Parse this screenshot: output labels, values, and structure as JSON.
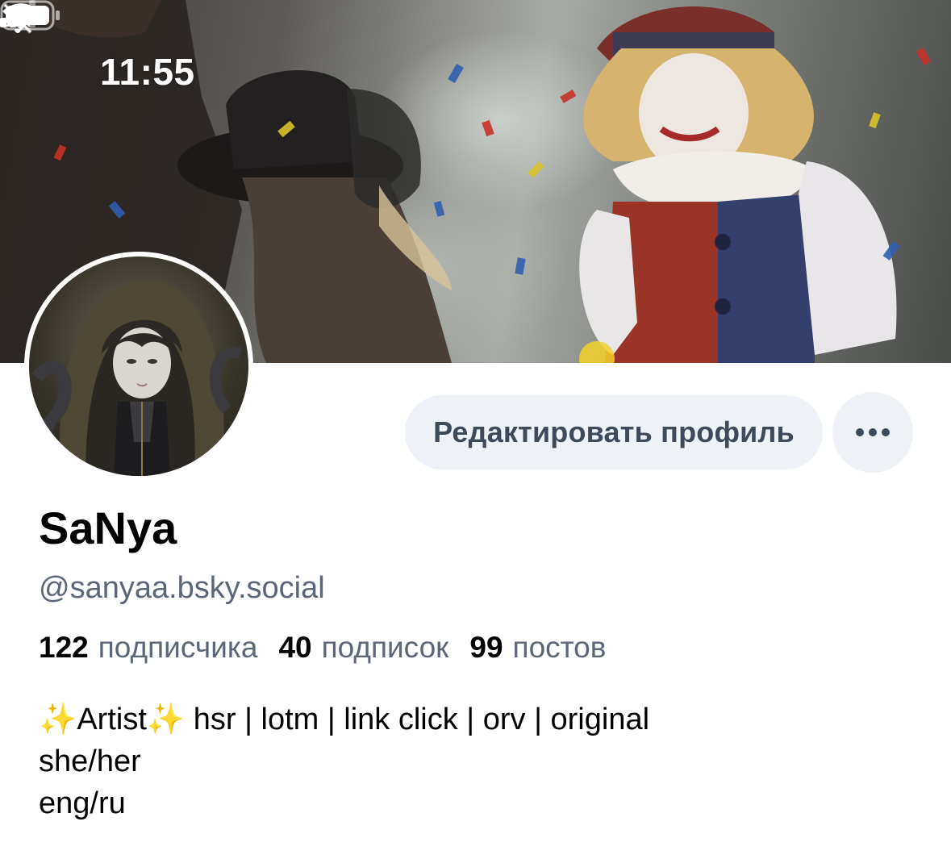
{
  "status_bar": {
    "time": "11:55",
    "icons": [
      "bell-slash-icon",
      "signal-icon",
      "wifi-icon",
      "battery-icon"
    ]
  },
  "banner": {
    "description_icon": "banner-image"
  },
  "avatar": {
    "icon": "avatar-image"
  },
  "actions": {
    "edit_profile_label": "Редактировать профиль",
    "more_icon": "ellipsis-icon"
  },
  "profile": {
    "display_name": "SaNya",
    "handle": "@sanyaa.bsky.social"
  },
  "stats": [
    {
      "value": "122",
      "label": "подписчика"
    },
    {
      "value": "40",
      "label": "подписок"
    },
    {
      "value": "99",
      "label": "постов"
    }
  ],
  "bio": {
    "lines": [
      "✨Artist✨ hsr | lotm | link click | orv | original",
      "she/her",
      "eng/ru"
    ]
  },
  "colors": {
    "button_bg": "#eef1f6",
    "button_text": "#3d4a5c",
    "secondary_text": "#5b6678",
    "primary_text": "#000000"
  }
}
